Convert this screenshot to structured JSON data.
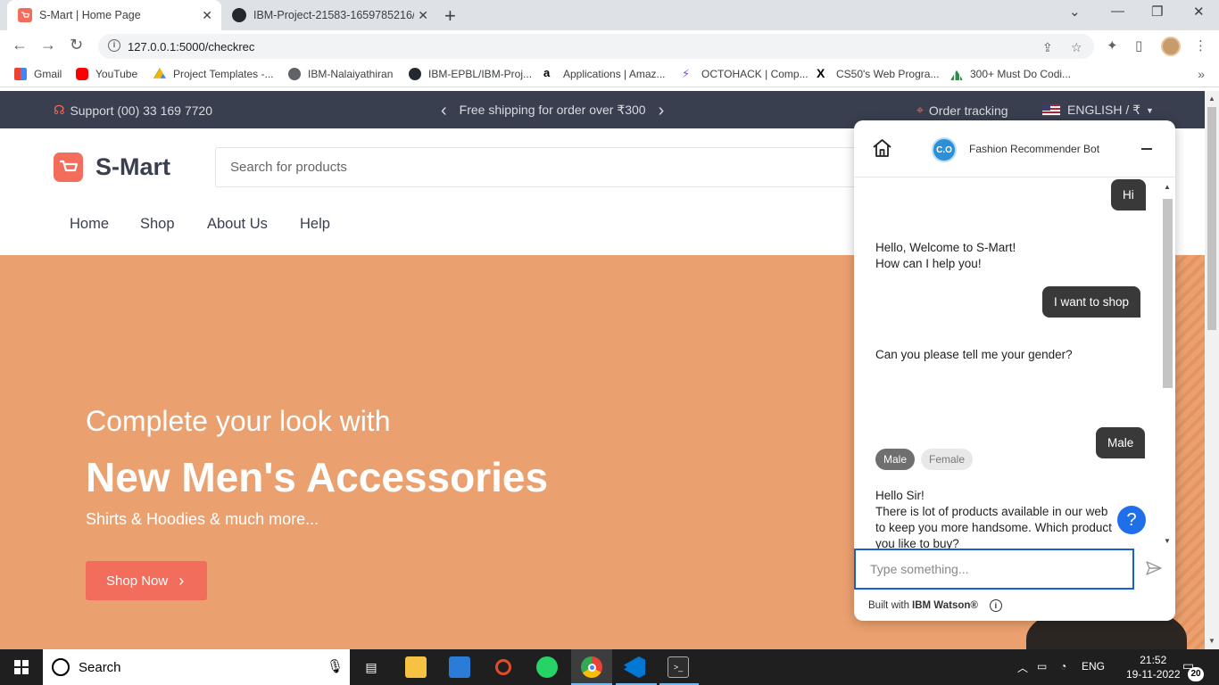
{
  "browser": {
    "tabs": [
      {
        "title": "S-Mart | Home Page",
        "active": true
      },
      {
        "title": "IBM-Project-21583-1659785216/",
        "active": false
      }
    ],
    "url": "127.0.0.1:5000/checkrec",
    "bookmarks": [
      {
        "label": "Gmail"
      },
      {
        "label": "YouTube"
      },
      {
        "label": "Project Templates -..."
      },
      {
        "label": "IBM-Nalaiyathiran"
      },
      {
        "label": "IBM-EPBL/IBM-Proj..."
      },
      {
        "label": "Applications | Amaz..."
      },
      {
        "label": "OCTOHACK | Comp..."
      },
      {
        "label": "CS50's Web Progra..."
      },
      {
        "label": "300+ Must Do Codi..."
      }
    ]
  },
  "site": {
    "topbar": {
      "support": "Support (00) 33 169 7720",
      "promo": "Free shipping for order over ₹300",
      "tracking": "Order tracking",
      "locale": "ENGLISH / ₹"
    },
    "brand": "S-Mart",
    "search_placeholder": "Search for products",
    "nav": [
      "Home",
      "Shop",
      "About Us",
      "Help"
    ],
    "hero": {
      "line1": "Complete your look with",
      "headline": "New Men's Accessories",
      "line2": "Shirts & Hoodies & much more...",
      "cta": "Shop Now"
    }
  },
  "chat": {
    "bot_name": "Fashion Recommender Bot",
    "bot_avatar": "C.O",
    "messages": [
      {
        "from": "user",
        "text": "Hi"
      },
      {
        "from": "bot",
        "lines": [
          "Hello, Welcome to S-Mart!",
          "How can I help you!"
        ]
      },
      {
        "from": "user",
        "text": "I want to shop"
      },
      {
        "from": "bot",
        "lines": [
          "Can you please tell me your gender?"
        ]
      },
      {
        "from": "user",
        "text": "Male"
      },
      {
        "from": "bot",
        "lines": [
          "Hello Sir!",
          "There is lot of products available in our web",
          "to keep you more handsome. Which product",
          "you like to buy?"
        ]
      }
    ],
    "options": [
      "Male",
      "Female"
    ],
    "input_placeholder": "Type something...",
    "footer_prefix": "Built with",
    "footer_brand": "IBM Watson®"
  },
  "taskbar": {
    "search_label": "Search",
    "lang": "ENG",
    "time": "21:52",
    "date": "19-11-2022",
    "notifications": "20"
  },
  "colors": {
    "accent": "#f26d5b",
    "hero_bg": "#eaa06f",
    "topbar_bg": "#3a3f4f",
    "chat_user_bubble": "#393939",
    "chat_input_border": "#1a5fd1"
  }
}
